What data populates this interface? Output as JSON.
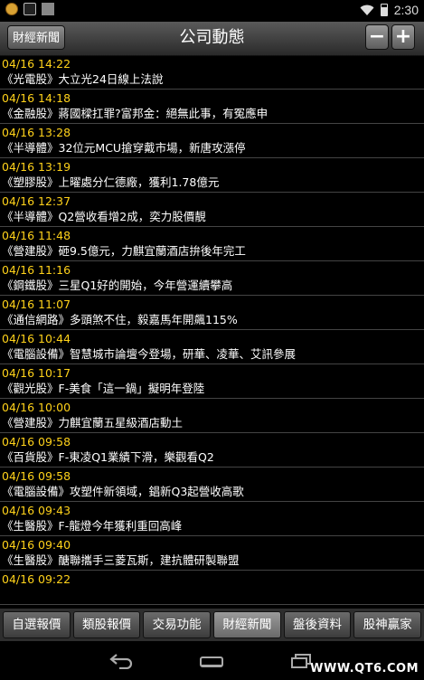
{
  "status_bar": {
    "time": "2:30"
  },
  "header": {
    "back_label": "財經新聞",
    "title": "公司動態",
    "zoom_out": "−",
    "zoom_in": "+"
  },
  "news": [
    {
      "date": "04/16 14:22",
      "text": "《光電股》大立光24日線上法說"
    },
    {
      "date": "04/16 14:18",
      "text": "《金融股》蔣國樑扛罪?富邦金：絕無此事，有冤應申"
    },
    {
      "date": "04/16 13:28",
      "text": "《半導體》32位元MCU搶穿戴市場，新唐攻漲停"
    },
    {
      "date": "04/16 13:19",
      "text": "《塑膠股》上曜處分仁德廠，獲利1.78億元"
    },
    {
      "date": "04/16 12:37",
      "text": "《半導體》Q2營收看增2成，奕力股價靚"
    },
    {
      "date": "04/16 11:48",
      "text": "《營建股》砸9.5億元，力麒宜蘭酒店拚後年完工"
    },
    {
      "date": "04/16 11:16",
      "text": "《鋼鐵股》三星Q1好的開始，今年營運續攀高"
    },
    {
      "date": "04/16 11:07",
      "text": "《通信網路》多頭煞不住，毅嘉馬年開飆115%"
    },
    {
      "date": "04/16 10:44",
      "text": "《電腦設備》智慧城市論壇今登場，研華、凌華、艾訊參展"
    },
    {
      "date": "04/16 10:17",
      "text": "《觀光股》F-美食「這一鍋」擬明年登陸"
    },
    {
      "date": "04/16 10:00",
      "text": "《營建股》力麒宜蘭五星級酒店動土"
    },
    {
      "date": "04/16 09:58",
      "text": "《百貨股》F-東凌Q1業績下滑，樂觀看Q2"
    },
    {
      "date": "04/16 09:58",
      "text": "《電腦設備》攻塑件新領域，錩新Q3起營收高歌"
    },
    {
      "date": "04/16 09:43",
      "text": "《生醫股》F-龍燈今年獲利重回高峰"
    },
    {
      "date": "04/16 09:40",
      "text": "《生醫股》醣聯攜手三菱瓦斯，建抗體研製聯盟"
    },
    {
      "date": "04/16 09:22",
      "text": ""
    }
  ],
  "tabs": [
    {
      "label": "自選報價"
    },
    {
      "label": "類股報價"
    },
    {
      "label": "交易功能"
    },
    {
      "label": "財經新聞"
    },
    {
      "label": "盤後資料"
    },
    {
      "label": "股神贏家"
    }
  ],
  "active_tab": 3,
  "watermark": "WWW.QT6.COM",
  "icons": {
    "status_left": [
      "coin-icon",
      "clipboard-icon",
      "square-icon"
    ],
    "status_right": [
      "wifi-icon",
      "battery-icon"
    ],
    "nav": [
      "back-icon",
      "home-icon",
      "recent-apps-icon"
    ]
  }
}
